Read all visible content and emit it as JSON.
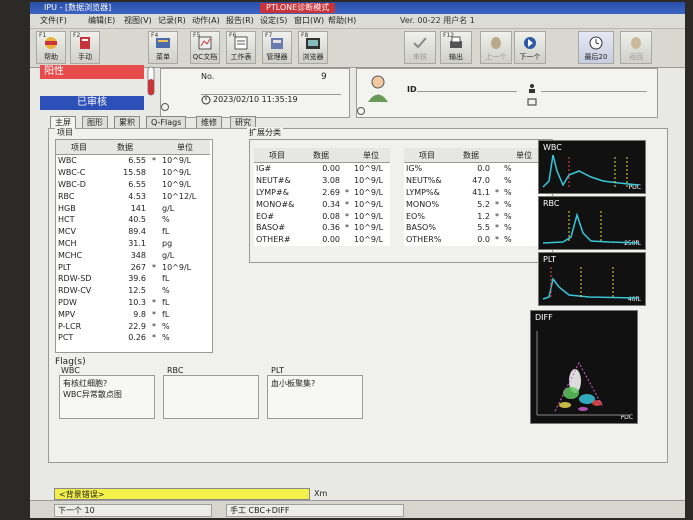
{
  "window": {
    "title": "IPU - [数据浏览器]",
    "mode_badge": "PTLONE诊断模式"
  },
  "menu": [
    "文件(F)",
    "编辑(E)",
    "视图(V)",
    "记录(R)",
    "动作(A)",
    "报告(R)",
    "设定(S)",
    "窗口(W)",
    "帮助(H)"
  ],
  "version_text": "Ver. 00-22 用户名 1",
  "toolbar": {
    "buttons": [
      {
        "key": "F1",
        "label": "帮助",
        "icon": "help-icon"
      },
      {
        "key": "F2",
        "label": "手动",
        "icon": "manual-icon"
      },
      {
        "key": "F4",
        "label": "菜单",
        "icon": "menu-icon"
      },
      {
        "key": "F5",
        "label": "QC文档",
        "icon": "qc-icon"
      },
      {
        "key": "F6",
        "label": "工作表",
        "icon": "worklist-icon"
      },
      {
        "key": "F7",
        "label": "管理器",
        "icon": "manager-icon"
      },
      {
        "key": "F8",
        "label": "浏览器",
        "icon": "browser-icon"
      },
      {
        "key": "",
        "label": "审核",
        "icon": "validate-icon"
      },
      {
        "key": "F12",
        "label": "输出",
        "icon": "output-icon"
      },
      {
        "key": "",
        "label": "上一个",
        "icon": "previous-icon"
      },
      {
        "key": "",
        "label": "下一个",
        "icon": "next-icon"
      },
      {
        "key": "",
        "label": "最后20",
        "icon": "last20-icon"
      },
      {
        "key": "",
        "label": "返回",
        "icon": "back-icon"
      }
    ]
  },
  "status": {
    "positive": "阳性",
    "reviewed": "已审核"
  },
  "sample": {
    "no_label": "No.",
    "no_value": "9",
    "datetime": "2023/02/10   11:35:19"
  },
  "patient": {
    "id_label": "ID"
  },
  "tabs": [
    "主屏",
    "图形",
    "累积",
    "Q-Flags",
    "维修",
    "研究"
  ],
  "main_table": {
    "group_title": "项目",
    "headers": [
      "项目",
      "数据",
      "",
      "单位"
    ],
    "rows": [
      [
        "WBC",
        "6.55",
        "*",
        "10^9/L"
      ],
      [
        "WBC-C",
        "15.58",
        "",
        "10^9/L"
      ],
      [
        "WBC-D",
        "6.55",
        "",
        "10^9/L"
      ],
      [
        "RBC",
        "4.53",
        "",
        "10^12/L"
      ],
      [
        "HGB",
        "141",
        "",
        "g/L"
      ],
      [
        "HCT",
        "40.5",
        "",
        "%"
      ],
      [
        "MCV",
        "89.4",
        "",
        "fL"
      ],
      [
        "MCH",
        "31.1",
        "",
        "pg"
      ],
      [
        "MCHC",
        "348",
        "",
        "g/L"
      ],
      [
        "PLT",
        "267",
        "*",
        "10^9/L"
      ],
      [
        "RDW-SD",
        "39.6",
        "",
        "fL"
      ],
      [
        "RDW-CV",
        "12.5",
        "",
        "%"
      ],
      [
        "PDW",
        "10.3",
        "*",
        "fL"
      ],
      [
        "MPV",
        "9.8",
        "*",
        "fL"
      ],
      [
        "P-LCR",
        "22.9",
        "*",
        "%"
      ],
      [
        "PCT",
        "0.26",
        "*",
        "%"
      ]
    ]
  },
  "diff_group": {
    "title": "扩展分类",
    "headers": [
      "项目",
      "数据",
      "",
      "单位"
    ],
    "abs_rows": [
      [
        "IG#",
        "0.00",
        "",
        "10^9/L"
      ],
      [
        "NEUT#&",
        "3.08",
        "",
        "10^9/L"
      ],
      [
        "LYMP#&",
        "2.69",
        "*",
        "10^9/L"
      ],
      [
        "MONO#&",
        "0.34",
        "*",
        "10^9/L"
      ],
      [
        "EO#",
        "0.08",
        "*",
        "10^9/L"
      ],
      [
        "BASO#",
        "0.36",
        "*",
        "10^9/L"
      ],
      [
        "OTHER#",
        "0.00",
        "",
        "10^9/L"
      ]
    ],
    "pct_rows": [
      [
        "IG%",
        "0.0",
        "",
        "%"
      ],
      [
        "NEUT%&",
        "47.0",
        "",
        "%"
      ],
      [
        "LYMP%&",
        "41.1",
        "*",
        "%"
      ],
      [
        "MONO%",
        "5.2",
        "*",
        "%"
      ],
      [
        "EO%",
        "1.2",
        "*",
        "%"
      ],
      [
        "BASO%",
        "5.5",
        "*",
        "%"
      ],
      [
        "OTHER%",
        "0.0",
        "*",
        "%"
      ]
    ]
  },
  "histograms": [
    {
      "title": "WBC",
      "unit": "PDC"
    },
    {
      "title": "RBC",
      "unit": "250fL"
    },
    {
      "title": "PLT",
      "unit": "40fL"
    },
    {
      "title": "DIFF",
      "unit": "PDC"
    }
  ],
  "flags": {
    "title": "Flag(s)",
    "wbc_label": "WBC",
    "rbc_label": "RBC",
    "plt_label": "PLT",
    "wbc_flags": [
      "有核红细胞?",
      "WBC异常散点图"
    ],
    "rbc_flags": [],
    "plt_flags": [
      "血小板聚集?"
    ]
  },
  "footer": {
    "background_error": "<背景错误>",
    "xm": "Xm",
    "next": "下一个 10",
    "manual_mode": "手工 CBC+DIFF"
  },
  "colors": {
    "positive": "#e84b4b",
    "reviewed": "#2d4fb8",
    "warning": "#f4f04a",
    "histogram_curve": "#37c7d9"
  }
}
